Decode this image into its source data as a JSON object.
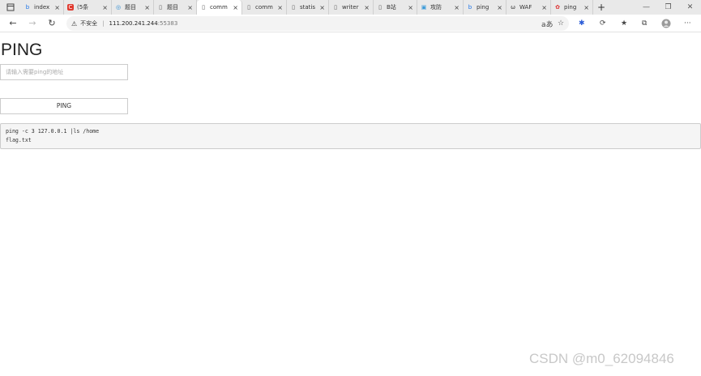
{
  "browser": {
    "tabs": [
      {
        "icon": "bing-icon",
        "label": "index"
      },
      {
        "icon": "csdn-icon",
        "label": "(5条"
      },
      {
        "icon": "circle-icon",
        "label": "题目"
      },
      {
        "icon": "page-icon",
        "label": "题目"
      },
      {
        "icon": "page-icon",
        "label": "comm"
      },
      {
        "icon": "page-icon",
        "label": "comm"
      },
      {
        "icon": "page-icon",
        "label": "statis"
      },
      {
        "icon": "page-icon",
        "label": "writer"
      },
      {
        "icon": "page-icon",
        "label": "B站"
      },
      {
        "icon": "tv-icon",
        "label": "攻防"
      },
      {
        "icon": "bing-icon",
        "label": "ping"
      },
      {
        "icon": "waf-icon",
        "label": "WAF"
      },
      {
        "icon": "redicon",
        "label": "ping"
      }
    ],
    "address": {
      "security_label": "不安全",
      "host": "111.200.241.244",
      "port": ":55383"
    }
  },
  "page": {
    "title": "PING",
    "input_placeholder": "请输入需要ping的地址",
    "button_label": "PING",
    "output_line1": "ping -c 3 127.0.0.1 |ls /home",
    "output_line2": "flag.txt"
  },
  "watermark": "CSDN @m0_62094846"
}
